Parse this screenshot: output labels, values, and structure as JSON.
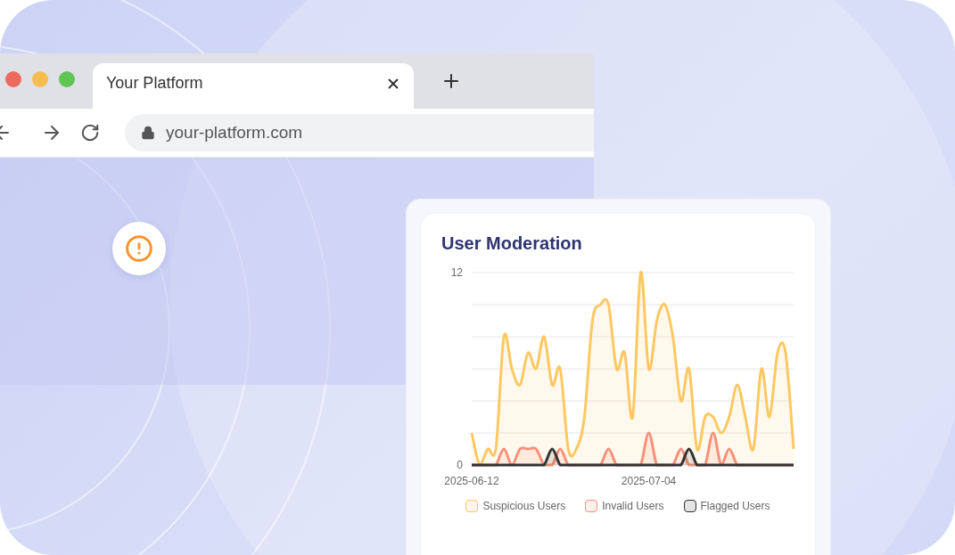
{
  "browser": {
    "tab_title": "Your Platform",
    "address": "your-platform.com"
  },
  "card": {
    "title": "User Moderation",
    "chart_data": {
      "type": "area",
      "categories": [
        "2025-06-12",
        null,
        null,
        null,
        null,
        null,
        null,
        null,
        null,
        null,
        null,
        null,
        null,
        null,
        null,
        null,
        null,
        null,
        null,
        null,
        null,
        null,
        "2025-07-04",
        null,
        null,
        null,
        null,
        null,
        null,
        null,
        null,
        null,
        null,
        null,
        null,
        null,
        null,
        null,
        null,
        null,
        null
      ],
      "series": [
        {
          "name": "Suspicious Users",
          "color": "#fdc862",
          "values": [
            2,
            0,
            1,
            1,
            8,
            6,
            5,
            7,
            6,
            8,
            5,
            6,
            1,
            1,
            3,
            9,
            10,
            10,
            6,
            7,
            3,
            12,
            6,
            9,
            10,
            8,
            4,
            6,
            1,
            3,
            3,
            2,
            3,
            5,
            3,
            1,
            6,
            3,
            7,
            7,
            1
          ]
        },
        {
          "name": "Invalid Users",
          "color": "#f8907a",
          "values": [
            0,
            0,
            0,
            0,
            1,
            0,
            1,
            1,
            1,
            0,
            0,
            1,
            0,
            0,
            0,
            0,
            0,
            1,
            0,
            0,
            0,
            0,
            2,
            0,
            0,
            0,
            1,
            0,
            0,
            0,
            2,
            0,
            1,
            0,
            0,
            0,
            0,
            0,
            0,
            0,
            0
          ]
        },
        {
          "name": "Flagged Users",
          "color": "#333333",
          "values": [
            0,
            0,
            0,
            0,
            0,
            0,
            0,
            0,
            0,
            0,
            1,
            0,
            0,
            0,
            0,
            0,
            0,
            0,
            0,
            0,
            0,
            0,
            0,
            0,
            0,
            0,
            0,
            1,
            0,
            0,
            0,
            0,
            0,
            0,
            0,
            0,
            0,
            0,
            0,
            0,
            0
          ]
        }
      ],
      "ylim": [
        0,
        12
      ],
      "yticks": [
        0,
        12
      ]
    }
  }
}
